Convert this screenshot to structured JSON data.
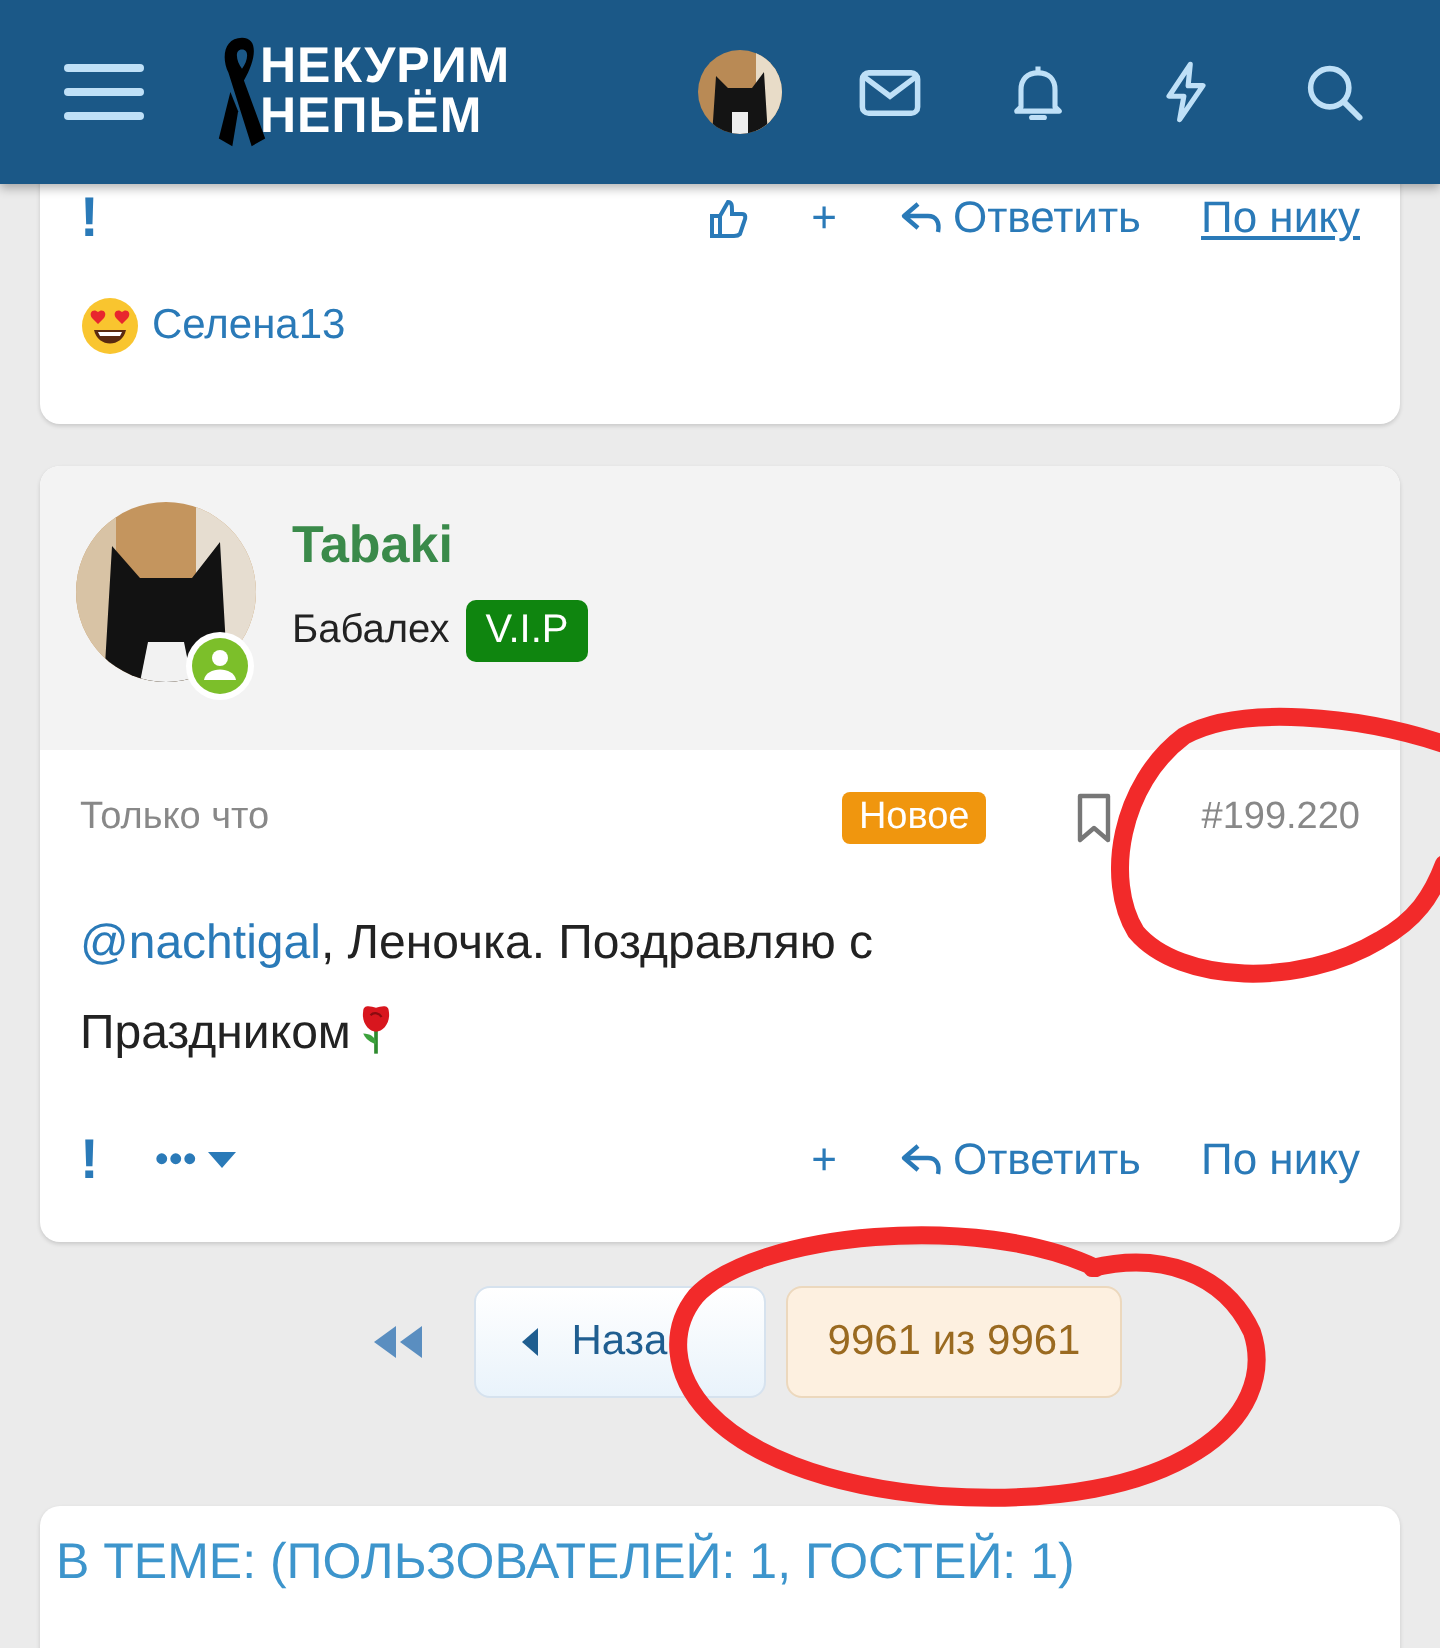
{
  "header": {
    "logo": {
      "line_1": "НЕКУРИМ",
      "line_2": "НЕПЬЁМ"
    }
  },
  "previous_post": {
    "actions": {
      "mark": "!",
      "plus": "+",
      "reply": "Ответить",
      "quote_by_nick": {
        "label": "По нику",
        "underlined": true
      }
    },
    "reactions": [
      {
        "user": "Селена13"
      }
    ]
  },
  "post": {
    "author": {
      "name": "Tabaki",
      "title": "Бабалех",
      "badge": "V.I.P",
      "online": true
    },
    "time": "Только что",
    "new_label": "Новое",
    "number": "#199.220",
    "body": {
      "mention": "@nachtigal",
      "text": ", Леночка. Поздравляю с Праздником"
    },
    "actions": {
      "mark": "!",
      "more": "•••",
      "plus": "+",
      "reply": "Ответить",
      "quote_by_nick": {
        "label": "По нику",
        "underlined": false
      }
    }
  },
  "pagination": {
    "prev": "Наза",
    "current": "9961 из 9961"
  },
  "online_block": {
    "title": "В ТЕМЕ: (ПОЛЬЗОВАТЕЛЕЙ: 1, ГОСТЕЙ: 1)"
  }
}
